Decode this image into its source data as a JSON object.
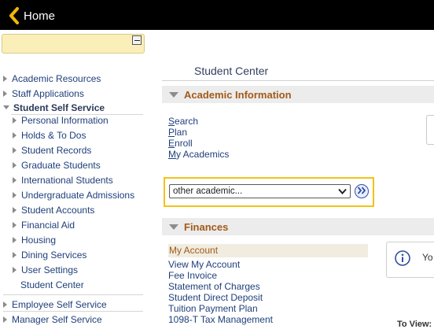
{
  "header": {
    "home_label": "Home"
  },
  "nav": {
    "items": [
      {
        "label": "Academic Resources"
      },
      {
        "label": "Staff Applications"
      },
      {
        "label": "Student Self Service"
      },
      {
        "label": "Personal Information"
      },
      {
        "label": "Holds & To Dos"
      },
      {
        "label": "Student Records"
      },
      {
        "label": "Graduate Students"
      },
      {
        "label": "International Students"
      },
      {
        "label": "Undergraduate Admissions"
      },
      {
        "label": "Student Accounts"
      },
      {
        "label": "Financial Aid"
      },
      {
        "label": "Housing"
      },
      {
        "label": "Dining Services"
      },
      {
        "label": "User Settings"
      },
      {
        "label": "Student Center"
      },
      {
        "label": "Employee Self Service"
      },
      {
        "label": "Manager Self Service"
      }
    ]
  },
  "main": {
    "page_title": "Student Center",
    "academic": {
      "header": "Academic Information",
      "links": [
        {
          "first": "S",
          "rest": "earch"
        },
        {
          "first": "P",
          "rest": "lan"
        },
        {
          "first": "E",
          "rest": "nroll"
        },
        {
          "first": "M",
          "rest": "y Academics"
        }
      ],
      "select_value": "other academic..."
    },
    "finances": {
      "header": "Finances",
      "my_account": "My Account",
      "links": [
        "View My Account",
        "Fee Invoice",
        "Statement of Charges",
        "Student Direct Deposit",
        "Tuition Payment Plan",
        "1098-T Tax Management"
      ],
      "info_text": "Yo",
      "to_view": "To View:"
    }
  },
  "colors": {
    "topbar": "#000000",
    "home_chevron": "#f2b705",
    "section_header_text": "#a25a18",
    "link": "#1f3f7a",
    "highlight_border": "#f2c318",
    "menu_box": "#fbefb9"
  }
}
